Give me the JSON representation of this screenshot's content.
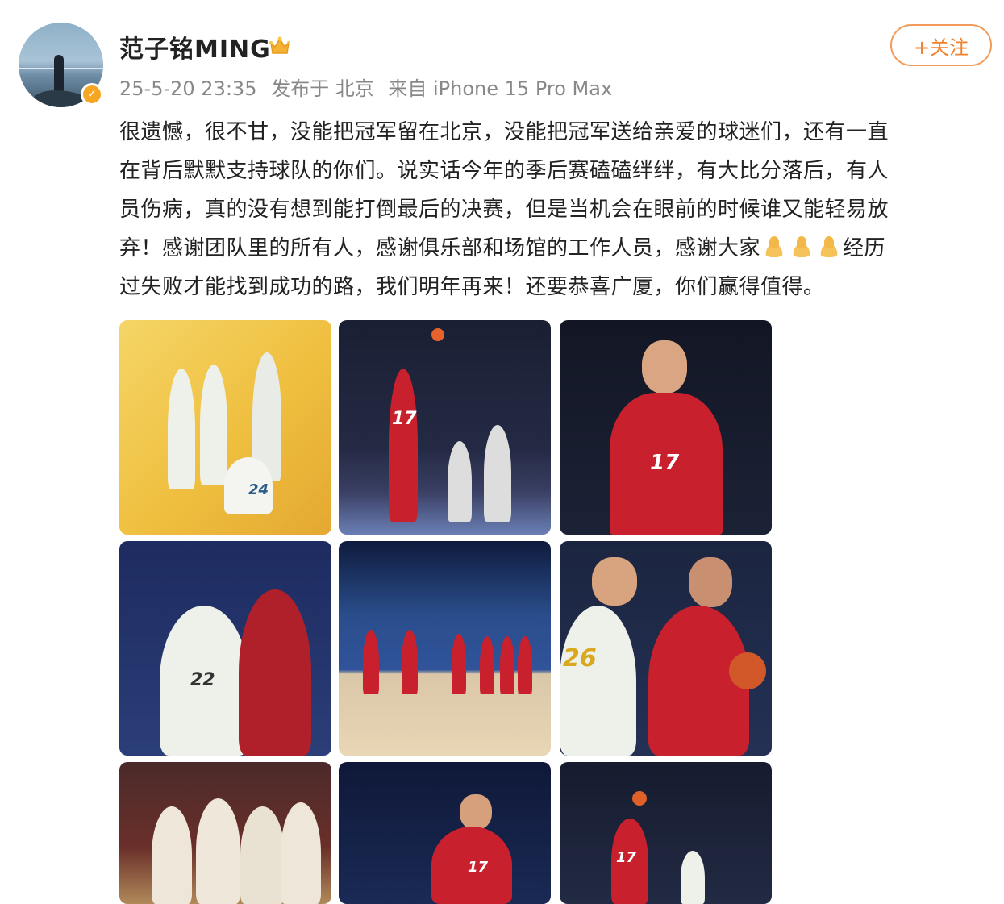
{
  "profile": {
    "username": "范子铭MING",
    "verified_icon": "v-verified-icon",
    "member_icon": "crown-icon"
  },
  "meta": {
    "date": "25-5-20 23:35",
    "location": "发布于 北京",
    "device": "来自 iPhone 15 Pro Max"
  },
  "follow_label": "+关注",
  "post": {
    "lines": [
      "很遗憾，很不甘，没能把冠军留在北京，没能把冠军送给亲爱的球迷们，还有一直",
      "在背后默默支持球队的你们。说实话今年的季后赛磕磕绊绊，有大比分落后，有人",
      "员伤病，真的没有想到能打倒最后的决赛，但是当机会在眼前的时候谁又能轻易放",
      "弃！感谢团队里的所有人，感谢俱乐部和场馆的工作人员，感谢大家",
      "经历",
      "过失败才能找到成功的路，我们明年再来！还要恭喜广厦，你们赢得值得。"
    ],
    "emoji_name": "pray-hands-icon"
  },
  "photos": [
    {
      "jersey": "24",
      "bg": "#f2c84b"
    },
    {
      "jersey": "17",
      "bg": "#1e2238"
    },
    {
      "jersey": "17",
      "bg": "#171b2b"
    },
    {
      "jersey": "22",
      "bg": "#2b3e78"
    },
    {
      "jersey": "",
      "bg": "#1f3f7a"
    },
    {
      "jersey": "26",
      "bg": "#1d2a46"
    },
    {
      "jersey": "",
      "bg": "#4a2a2a"
    },
    {
      "jersey": "17",
      "bg": "#15203f"
    },
    {
      "jersey": "17",
      "bg": "#1b2236"
    }
  ],
  "colors": {
    "accent": "#f27f2a",
    "team_red": "#c8202c",
    "team_white": "#eef0ea"
  }
}
